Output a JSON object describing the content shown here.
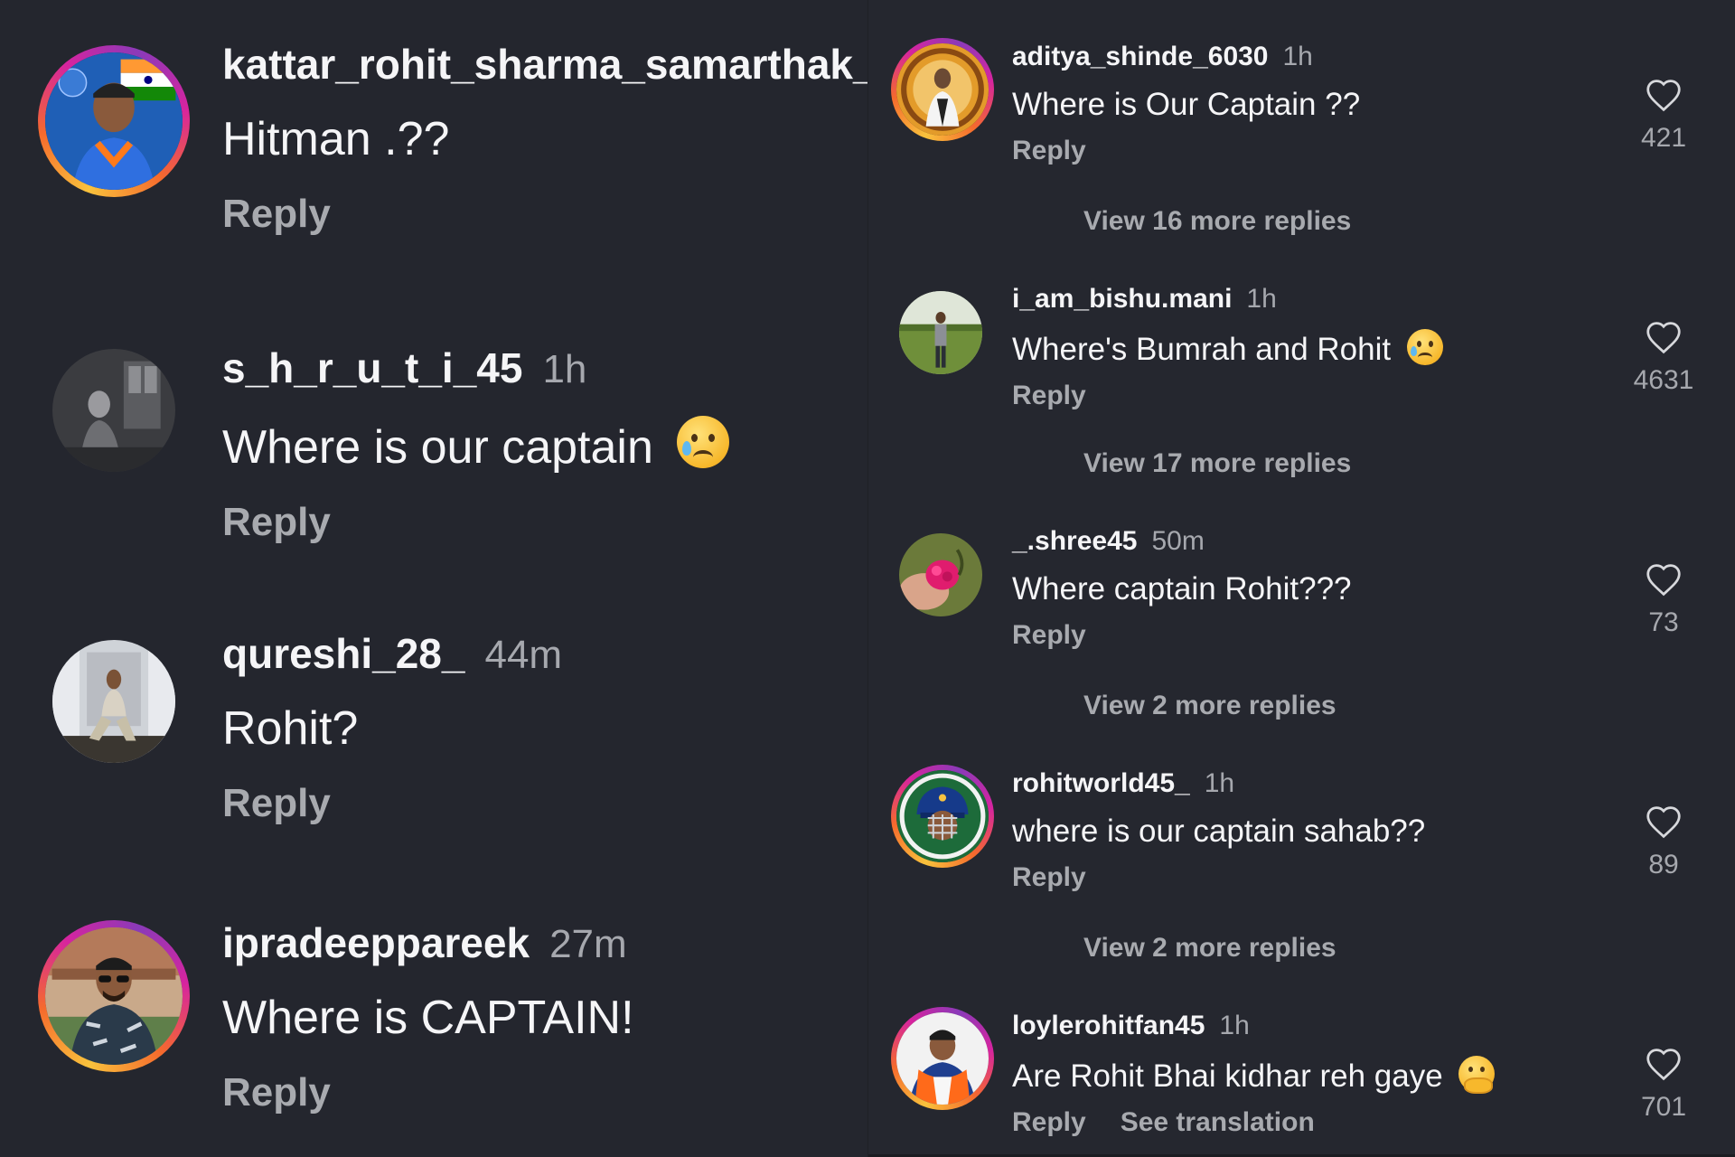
{
  "left": {
    "comments": [
      {
        "username": "kattar_rohit_sharma_samarthak_",
        "time": "",
        "text": "Hitman .??",
        "reply": "Reply"
      },
      {
        "username": "s_h_r_u_t_i_45",
        "time": "1h",
        "text": "Where is our captain",
        "emoji": "crying-face",
        "reply": "Reply"
      },
      {
        "username": "qureshi_28_",
        "time": "44m",
        "text": "Rohit?",
        "reply": "Reply"
      },
      {
        "username": "ipradeeppareek",
        "time": "27m",
        "text": "Where is CAPTAIN!",
        "reply": "Reply"
      }
    ]
  },
  "right": {
    "comments": [
      {
        "username": "aditya_shinde_6030",
        "time": "1h",
        "text": "Where is Our Captain ??",
        "reply": "Reply",
        "likes": "421",
        "more_replies": "View 16 more replies"
      },
      {
        "username": "i_am_bishu.mani",
        "time": "1h",
        "text": "Where's Bumrah and Rohit",
        "emoji": "crying-face",
        "reply": "Reply",
        "likes": "4631",
        "more_replies": "View 17 more replies"
      },
      {
        "username": "_.shree45",
        "time": "50m",
        "text": "Where captain Rohit???",
        "reply": "Reply",
        "likes": "73",
        "more_replies": "View 2 more replies"
      },
      {
        "username": "rohitworld45_",
        "time": "1h",
        "text": "where is our captain sahab??",
        "reply": "Reply",
        "likes": "89",
        "more_replies": "View 2 more replies"
      },
      {
        "username": "loylerohitfan45",
        "time": "1h",
        "text": "Are Rohit Bhai kidhar reh gaye",
        "emoji": "face-with-hand-over-mouth",
        "reply": "Reply",
        "see_translation": "See translation",
        "likes": "701"
      }
    ]
  },
  "colors": {
    "background": "#24262e",
    "primary_text": "#f5f5f7",
    "secondary_text": "#a8aaaf",
    "story_ring": [
      "#f9c23c",
      "#f56a2d",
      "#d6249f"
    ]
  },
  "icons": {
    "like": "heart-outline-icon"
  }
}
